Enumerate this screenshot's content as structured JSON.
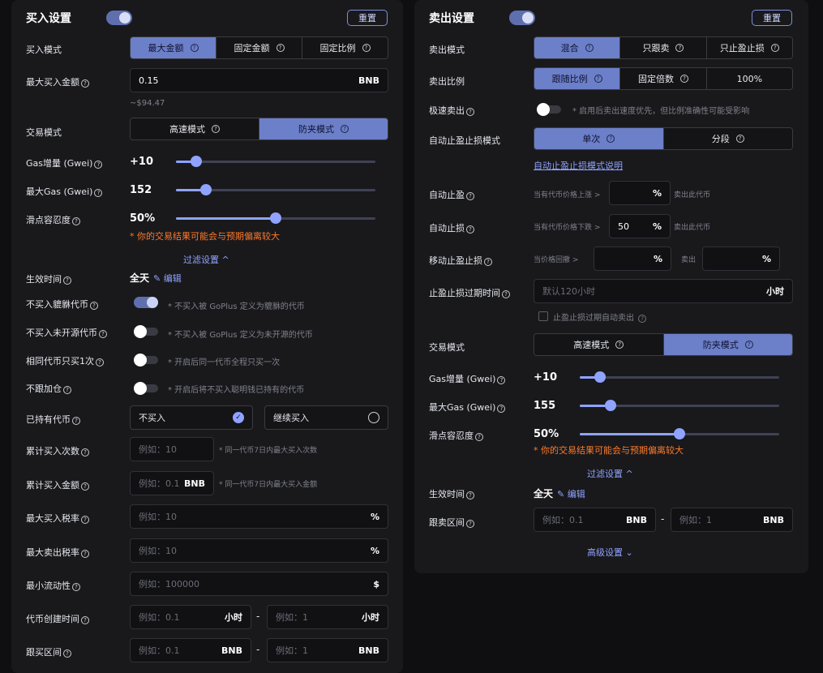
{
  "buy": {
    "title": "买入设置",
    "reset": "重置",
    "mode_label": "买入模式",
    "modes": [
      "最大金额",
      "固定金额",
      "固定比例"
    ],
    "max_amount_label": "最大买入金额",
    "max_amount_value": "0.15",
    "max_amount_unit": "BNB",
    "max_amount_usd": "~$94.47",
    "trade_mode_label": "交易模式",
    "trade_modes": [
      "高速模式",
      "防夹模式"
    ],
    "gas_label": "Gas增量 (Gwei)",
    "gas_value": "+10",
    "gas_level": 0.1,
    "maxgas_label": "最大Gas (Gwei)",
    "maxgas_value": "152",
    "maxgas_level": 0.15,
    "slip_label": "滑点容忍度",
    "slip_value": "50%",
    "slip_level": 0.5,
    "slip_warning": "* 你的交易结果可能会与预期偏离较大",
    "filter_link": "过滤设置",
    "effective_label": "生效时间",
    "effective_value": "全天",
    "edit": "编辑",
    "honeypot_label": "不买入貔貅代币",
    "honeypot_hint": "* 不买入被 GoPlus 定义为貔貅的代币",
    "opensource_label": "不买入未开源代币",
    "opensource_hint": "* 不买入被 GoPlus 定义为未开源的代币",
    "once_label": "相同代币只买1次",
    "once_hint": "* 开启后同一代币全程只买一次",
    "nofollow_label": "不跟加仓",
    "nofollow_hint": "* 开启后将不买入聪明钱已持有的代币",
    "held_label": "已持有代币",
    "held_options": [
      "不买入",
      "继续买入"
    ],
    "count_label": "累计买入次数",
    "count_placeholder": "例如：10",
    "count_hint": "* 同一代币7日内最大买入次数",
    "total_label": "累计买入金额",
    "total_placeholder": "例如：0.1",
    "total_unit": "BNB",
    "total_hint": "* 同一代币7日内最大买入金额",
    "buytax_label": "最大买入税率",
    "buytax_placeholder": "例如：10",
    "selltax_label": "最大卖出税率",
    "selltax_placeholder": "例如：10",
    "percent": "%",
    "liq_label": "最小流动性",
    "liq_placeholder": "例如：100000",
    "liq_unit": "$",
    "created_label": "代币创建时间",
    "created_min_placeholder": "例如：0.1",
    "created_max_placeholder": "例如：1",
    "hour_unit": "小时",
    "range_label": "跟买区间",
    "range_min_placeholder": "例如：0.1",
    "range_max_placeholder": "例如：1",
    "range_unit": "BNB",
    "dash": "-"
  },
  "sell": {
    "title": "卖出设置",
    "reset": "重置",
    "mode_label": "卖出模式",
    "modes": [
      "混合",
      "只跟卖",
      "只止盈止损"
    ],
    "ratio_label": "卖出比例",
    "ratios": [
      "跟随比例",
      "固定倍数",
      "100%"
    ],
    "fast_label": "极速卖出",
    "fast_hint": "* 启用后卖出速度优先，但比例准确性可能受影响",
    "auto_mode_label": "自动止盈止损模式",
    "auto_modes": [
      "单次",
      "分段"
    ],
    "auto_mode_link": "自动止盈止损模式说明",
    "tp_label": "自动止盈",
    "tp_prefix": "当有代币价格上涨 >",
    "tp_suffix": "卖出此代币",
    "sl_label": "自动止损",
    "sl_prefix": "当有代币价格下跌 >",
    "sl_value": "50",
    "sl_suffix": "卖出此代币",
    "trail_label": "移动止盈止损",
    "trail_prefix": "当价格回撤 >",
    "trail_mid": "卖出",
    "percent": "%",
    "expire_label": "止盈止损过期时间",
    "expire_placeholder": "默认120小时",
    "expire_unit": "小时",
    "expire_check": "止盈止损过期自动卖出",
    "trade_mode_label": "交易模式",
    "trade_modes": [
      "高速模式",
      "防夹模式"
    ],
    "gas_label": "Gas增量 (Gwei)",
    "gas_value": "+10",
    "gas_level": 0.1,
    "maxgas_label": "最大Gas (Gwei)",
    "maxgas_value": "155",
    "maxgas_level": 0.155,
    "slip_label": "滑点容忍度",
    "slip_value": "50%",
    "slip_level": 0.5,
    "slip_warning": "* 你的交易结果可能会与预期偏离较大",
    "filter_link": "过滤设置",
    "effective_label": "生效时间",
    "effective_value": "全天",
    "edit": "编辑",
    "range_label": "跟卖区间",
    "range_min_placeholder": "例如：0.1",
    "range_max_placeholder": "例如：1",
    "range_unit": "BNB",
    "dash": "-",
    "advanced_link": "高级设置"
  }
}
